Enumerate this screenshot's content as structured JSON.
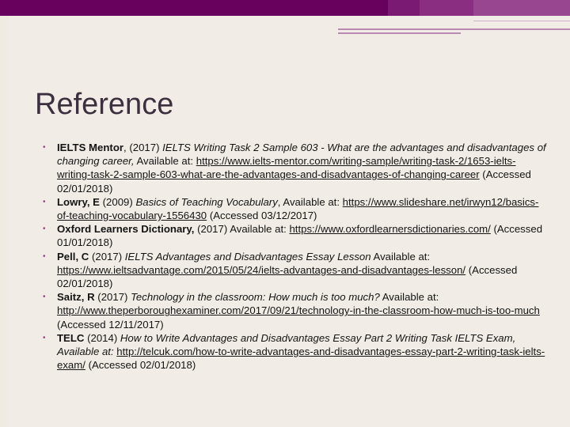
{
  "slide": {
    "title": "Reference",
    "colors": {
      "top_band": "#68005e",
      "bullet": "#a0418f",
      "title": "#3c3040",
      "background": "#f1ede6"
    },
    "bullet_glyph": "•",
    "references": [
      {
        "author": "IELTS Mentor",
        "sep1": ", (2017) ",
        "work": "IELTS Writing Task 2 Sample 603 - What are the advantages and disadvantages of changing career,",
        "avail": " Available at: ",
        "url": "https://www.ielts-mentor.com/writing-sample/writing-task-2/1653-ielts-writing-task-2-sample-603-what-are-the-advantages-and-disadvantages-of-changing-career",
        "accessed": " (Accessed 02/01/2018)"
      },
      {
        "author": "Lowry, E",
        "sep1": " (2009) ",
        "work": "Basics of Teaching Vocabulary",
        "avail": ", Available at: ",
        "url": "https://www.slideshare.net/irwyn12/basics-of-teaching-vocabulary-1556430",
        "accessed": " (Accessed 03/12/2017)"
      },
      {
        "author": "Oxford Learners Dictionary,",
        "sep1": " (2017) ",
        "work": "",
        "avail": "Available at: ",
        "url": "https://www.oxfordlearnersdictionaries.com/",
        "accessed": " (Accessed 01/01/2018)"
      },
      {
        "author": "Pell, C",
        "sep1": " (2017) ",
        "work": "IELTS Advantages and Disadvantages Essay Lesson",
        "avail": " Available at: ",
        "url": "https://www.ieltsadvantage.com/2015/05/24/ielts-advantages-and-disadvantages-lesson/",
        "accessed": " (Accessed 02/01/2018)"
      },
      {
        "author": "Saitz, R",
        "sep1": " (2017) ",
        "work": "Technology in the classroom: How much is too much?",
        "avail": " Available at: ",
        "url": "http://www.theperboroughexaminer.com/2017/09/21/technology-in-the-classroom-how-much-is-too-much",
        "accessed": " (Accessed 12/11/2017)"
      },
      {
        "author": "TELC",
        "sep1": " (2014) ",
        "work": "How to Write Advantages and Disadvantages Essay Part 2 Writing Task IELTS Exam, Available at:",
        "avail": " ",
        "url": "http://telcuk.com/how-to-write-advantages-and-disadvantages-essay-part-2-writing-task-ielts-exam/",
        "accessed": " (Accessed 02/01/2018)"
      }
    ]
  }
}
